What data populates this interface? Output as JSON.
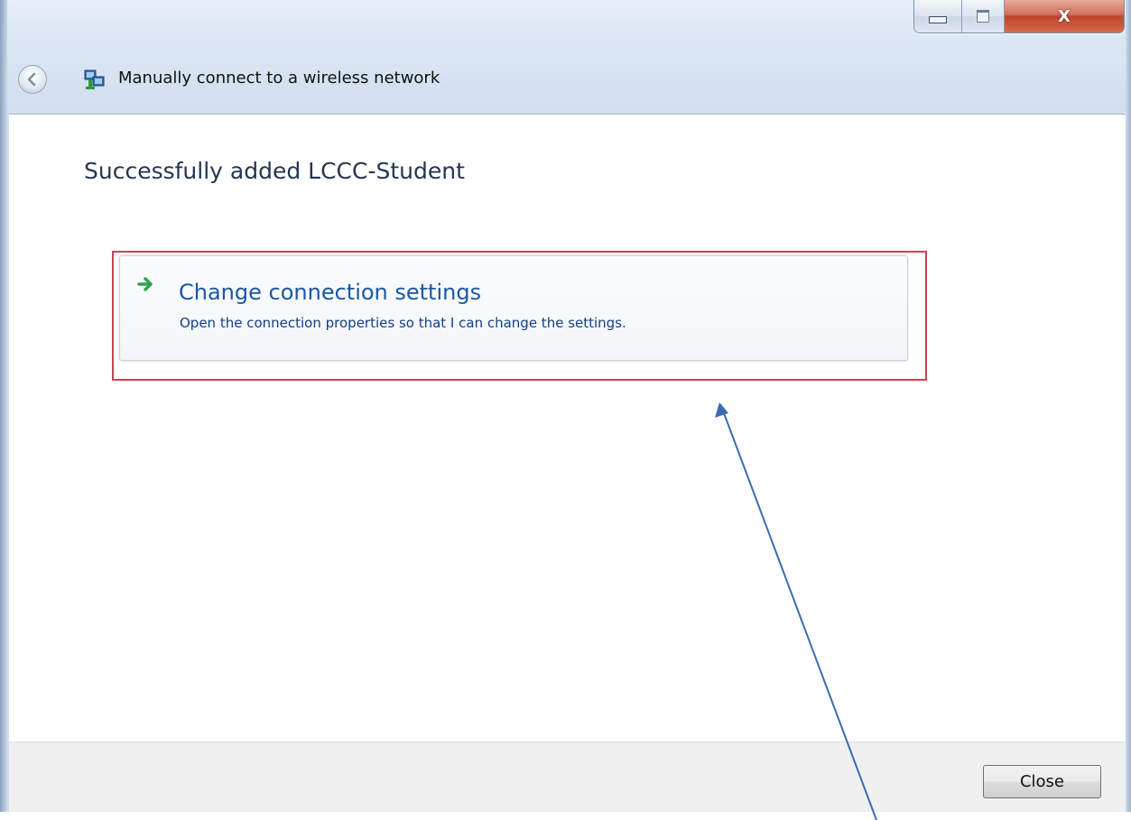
{
  "window": {
    "title": "Manually connect to a wireless network",
    "controls": {
      "minimize_icon": "minimize-icon",
      "maximize_icon": "maximize-icon",
      "close_glyph": "X"
    }
  },
  "content": {
    "heading": "Successfully added LCCC-Student",
    "option": {
      "icon": "green-arrow-icon",
      "title": "Change connection settings",
      "description": "Open the connection properties so that I can change the settings."
    }
  },
  "footer": {
    "close_label": "Close"
  },
  "colors": {
    "highlight": "#c3474d",
    "link": "#1b57a6",
    "annotation_arrow": "#3d6bb0"
  }
}
